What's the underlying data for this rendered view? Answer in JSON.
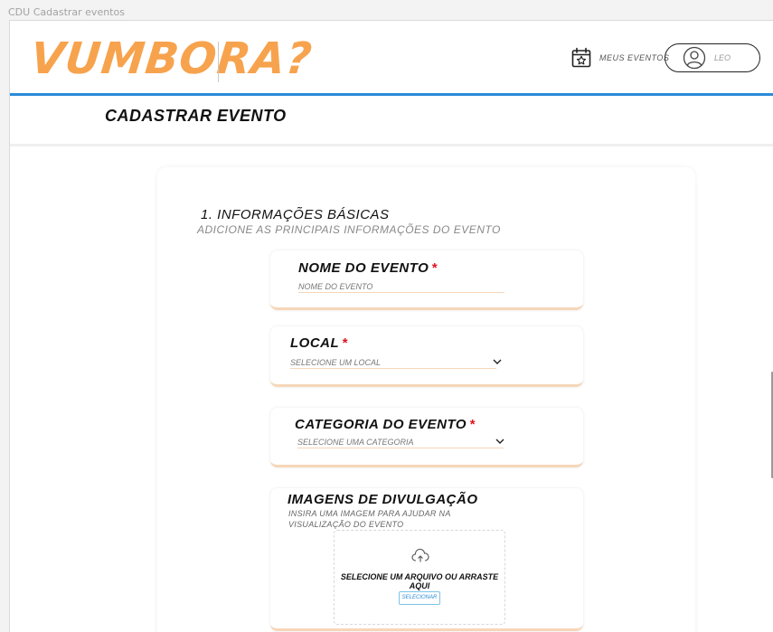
{
  "frame_title": "CDU Cadastrar eventos",
  "header": {
    "logo": "VUMBORA?",
    "my_events_label": "MEUS EVENTOS",
    "user_name": "LEO"
  },
  "page_title": "CADASTRAR EVENTO",
  "section": {
    "title": "1. INFORMAÇÕES BÁSICAS",
    "subtitle": "ADICIONE AS PRINCIPAIS INFORMAÇÕES DO EVENTO"
  },
  "fields": {
    "name": {
      "label": "NOME DO EVENTO",
      "required_mark": "*",
      "placeholder": "NOME DO EVENTO"
    },
    "location": {
      "label": "LOCAL",
      "required_mark": "*",
      "placeholder": "SELECIONE UM LOCAL"
    },
    "category": {
      "label": "CATEGORIA DO EVENTO",
      "required_mark": "*",
      "placeholder": "SELECIONE UMA CATEGORIA"
    },
    "images": {
      "label": "IMAGENS DE DIVULGAÇÃO",
      "description": "INSIRA UMA IMAGEM PARA AJUDAR NA VISUALIZAÇÃO DO EVENTO",
      "drop_text": "SELECIONE UM ARQUIVO OU ARRASTE AQUI",
      "button_label": "SELECIONAR"
    }
  },
  "colors": {
    "brand_orange": "#f7a34d",
    "accent_blue": "#2b8bd8",
    "required_red": "#e0141e",
    "field_underline": "#f6d6b8"
  },
  "icons": [
    "calendar-star-icon",
    "user-avatar-icon",
    "chevron-down-icon",
    "upload-cloud-icon"
  ]
}
